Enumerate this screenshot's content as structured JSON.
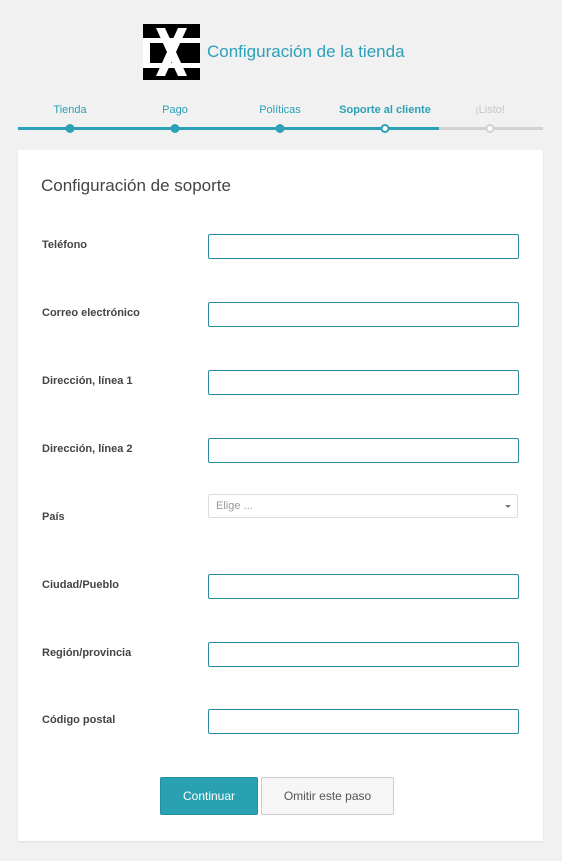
{
  "header": {
    "title": "Configuración de la tienda",
    "logo": "x-logo"
  },
  "steps": [
    {
      "label": "Tienda",
      "state": "done"
    },
    {
      "label": "Pago",
      "state": "done"
    },
    {
      "label": "Políticas",
      "state": "done"
    },
    {
      "label": "Soporte al cliente",
      "state": "active"
    },
    {
      "label": "¡Listo!",
      "state": "pending"
    }
  ],
  "colors": {
    "accent": "#2ba0b7",
    "pending": "#d1d1d1",
    "background": "#f1f1f1"
  },
  "form": {
    "title": "Configuración de soporte",
    "fields": [
      {
        "label": "Teléfono",
        "value": "",
        "placeholder": ""
      },
      {
        "label": "Correo electrónico",
        "value": "",
        "placeholder": ""
      },
      {
        "label": "Dirección, línea 1",
        "value": "",
        "placeholder": ""
      },
      {
        "label": "Dirección, línea 2",
        "value": "",
        "placeholder": ""
      },
      {
        "label": "País",
        "type": "select",
        "selected": "Elige ..."
      },
      {
        "label": "Ciudad/Pueblo",
        "value": "",
        "placeholder": ""
      },
      {
        "label": "Región/provincia",
        "value": "",
        "placeholder": ""
      },
      {
        "label": "Código postal",
        "value": "",
        "placeholder": ""
      }
    ]
  },
  "actions": {
    "continue_label": "Continuar",
    "skip_label": "Omitir este paso"
  }
}
